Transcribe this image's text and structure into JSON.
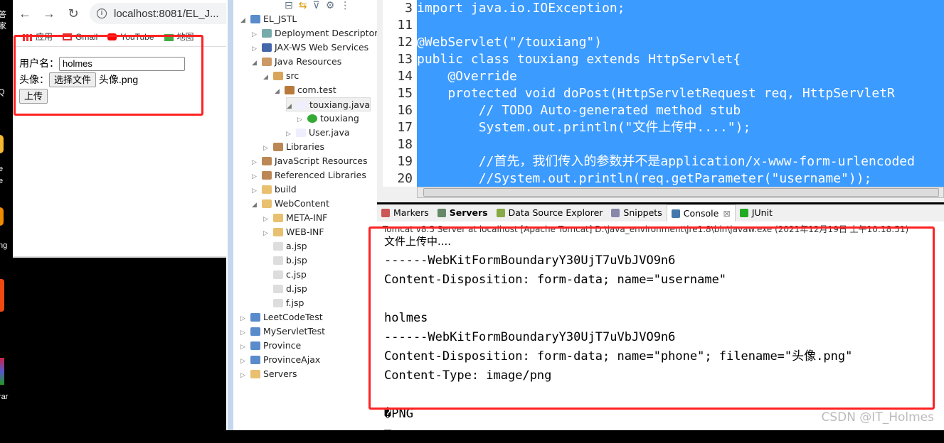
{
  "desktop": {
    "labels": [
      "答家",
      "Q",
      "e",
      "e",
      "ng",
      "rar"
    ]
  },
  "browser": {
    "url": "localhost:8081/EL_J...",
    "bookmarks": [
      "应用",
      "Gmail",
      "YouTube",
      "地图"
    ],
    "form": {
      "username_label": "用户名：",
      "username_value": "holmes",
      "avatar_label": "头像：",
      "choose_file_label": "选择文件",
      "file_name": "头像.png",
      "submit_label": "上传"
    }
  },
  "project_explorer": {
    "items": [
      {
        "label": "EL_JSTL",
        "level": 0,
        "state": "open",
        "icon": "project-icon"
      },
      {
        "label": "Deployment Descriptor:",
        "level": 1,
        "state": "closed",
        "icon": "deployment-descriptor-icon"
      },
      {
        "label": "JAX-WS Web Services",
        "level": 1,
        "state": "closed",
        "icon": "web-services-icon"
      },
      {
        "label": "Java Resources",
        "level": 1,
        "state": "open",
        "icon": "java-resources-icon"
      },
      {
        "label": "src",
        "level": 2,
        "state": "open",
        "icon": "source-folder-icon"
      },
      {
        "label": "com.test",
        "level": 3,
        "state": "open",
        "icon": "package-icon"
      },
      {
        "label": "touxiang.java",
        "level": 4,
        "state": "open",
        "icon": "java-file-icon",
        "selected": true
      },
      {
        "label": "touxiang",
        "level": 5,
        "state": "closed",
        "icon": "class-icon"
      },
      {
        "label": "User.java",
        "level": 4,
        "state": "closed",
        "icon": "java-file-icon"
      },
      {
        "label": "Libraries",
        "level": 2,
        "state": "closed",
        "icon": "library-icon"
      },
      {
        "label": "JavaScript Resources",
        "level": 1,
        "state": "closed",
        "icon": "library-icon"
      },
      {
        "label": "Referenced Libraries",
        "level": 1,
        "state": "closed",
        "icon": "library-icon"
      },
      {
        "label": "build",
        "level": 1,
        "state": "closed",
        "icon": "folder-icon"
      },
      {
        "label": "WebContent",
        "level": 1,
        "state": "open",
        "icon": "folder-icon"
      },
      {
        "label": "META-INF",
        "level": 2,
        "state": "closed",
        "icon": "folder-icon"
      },
      {
        "label": "WEB-INF",
        "level": 2,
        "state": "closed",
        "icon": "folder-icon"
      },
      {
        "label": "a.jsp",
        "level": 2,
        "state": "none",
        "icon": "jsp-file-icon"
      },
      {
        "label": "b.jsp",
        "level": 2,
        "state": "none",
        "icon": "jsp-file-icon"
      },
      {
        "label": "c.jsp",
        "level": 2,
        "state": "none",
        "icon": "jsp-file-icon"
      },
      {
        "label": "d.jsp",
        "level": 2,
        "state": "none",
        "icon": "jsp-file-icon"
      },
      {
        "label": "f.jsp",
        "level": 2,
        "state": "none",
        "icon": "jsp-file-icon"
      },
      {
        "label": "LeetCodeTest",
        "level": 0,
        "state": "closed",
        "icon": "project-icon"
      },
      {
        "label": "MyServletTest",
        "level": 0,
        "state": "closed",
        "icon": "project-icon"
      },
      {
        "label": "Province",
        "level": 0,
        "state": "closed",
        "icon": "project-icon"
      },
      {
        "label": "ProvinceAjax",
        "level": 0,
        "state": "closed",
        "icon": "project-icon"
      },
      {
        "label": "Servers",
        "level": 0,
        "state": "closed",
        "icon": "folder-icon"
      }
    ]
  },
  "editor": {
    "selection_color": "#3c9bff",
    "lines": [
      {
        "num": "3",
        "text": "import java.io.IOException;"
      },
      {
        "num": "11",
        "text": ""
      },
      {
        "num": "12",
        "text": "@WebServlet(\"/touxiang\")"
      },
      {
        "num": "13",
        "text": "public class touxiang extends HttpServlet{"
      },
      {
        "num": "14",
        "text": "    @Override"
      },
      {
        "num": "15",
        "text": "    protected void doPost(HttpServletRequest req, HttpServletR"
      },
      {
        "num": "16",
        "text": "        // TODO Auto-generated method stub"
      },
      {
        "num": "17",
        "text": "        System.out.println(\"文件上传中....\");"
      },
      {
        "num": "18",
        "text": ""
      },
      {
        "num": "19",
        "text": "        //首先，我们传入的参数并不是application/x-www-form-urlencoded "
      },
      {
        "num": "20",
        "text": "        //System.out.println(req.getParameter(\"username\"));"
      }
    ]
  },
  "tabs": [
    {
      "label": "Markers",
      "icon": "markers-icon"
    },
    {
      "label": "Servers",
      "icon": "servers-icon",
      "bold": true
    },
    {
      "label": "Data Source Explorer",
      "icon": "data-source-icon"
    },
    {
      "label": "Snippets",
      "icon": "snippets-icon"
    },
    {
      "label": "Console",
      "icon": "console-icon",
      "active": true,
      "close": "⊠"
    },
    {
      "label": "JUnit",
      "icon": "junit-icon"
    }
  ],
  "console": {
    "header": "Tomcat v8.5 Server at localhost [Apache Tomcat] D:\\java_environment\\jre1.8\\bin\\javaw.exe (2021年12月19日 上午10:18:51)",
    "lines": [
      "文件上传中....",
      "------WebKitFormBoundaryY30UjT7uVbJVO9n6",
      "Content-Disposition: form-data; name=\"username\"",
      "",
      "holmes",
      "------WebKitFormBoundaryY30UjT7uVbJVO9n6",
      "Content-Disposition: form-data; name=\"phone\"; filename=\"头像.png\"",
      "Content-Type: image/png",
      "",
      "�PNG",
      "□"
    ]
  },
  "watermark": "CSDN @IT_Holmes",
  "colors": {
    "highlight_box": "#ff2222",
    "selection": "#3c9bff"
  }
}
